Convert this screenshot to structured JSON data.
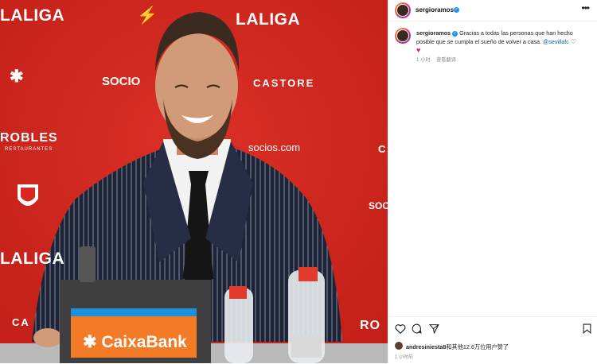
{
  "post": {
    "author": "sergioramos",
    "caption_user": "sergioramos",
    "caption_text": "Gracias a todas las personas que han hecho posible que se cumpla el sueño de volver a casa.",
    "caption_mention": "@sevillafc",
    "time_ago": "1 小时",
    "translate_label": "查看翻译",
    "liked_by_text": "andresiniesta8和其他12.6万位用户赞了",
    "liked_user": "andresiniesta8",
    "liked_rest": "和其他12.6万位用户赞了",
    "footer_time": "1 小时前"
  },
  "photo": {
    "sponsors": {
      "laliga": "LALIGA",
      "socios": "SOCIO",
      "socios_com": "socios.com",
      "castore": "CASTORE",
      "robles": "ROBLES",
      "robles_sub": "RESTAURANTES",
      "robles_right": "RO",
      "caixabank": "CaixaBank",
      "sc": "SOC",
      "ca": "CA",
      "c": "C"
    }
  },
  "icons": {
    "more": "more-options-icon",
    "verified": "verified-badge-icon",
    "like": "heart-icon",
    "comment": "comment-icon",
    "share": "share-icon",
    "save": "bookmark-icon"
  },
  "colors": {
    "backdrop": "#d8281f",
    "verified": "#1b95f2",
    "mention": "#0b67b4",
    "caixa_orange": "#f37a27"
  }
}
